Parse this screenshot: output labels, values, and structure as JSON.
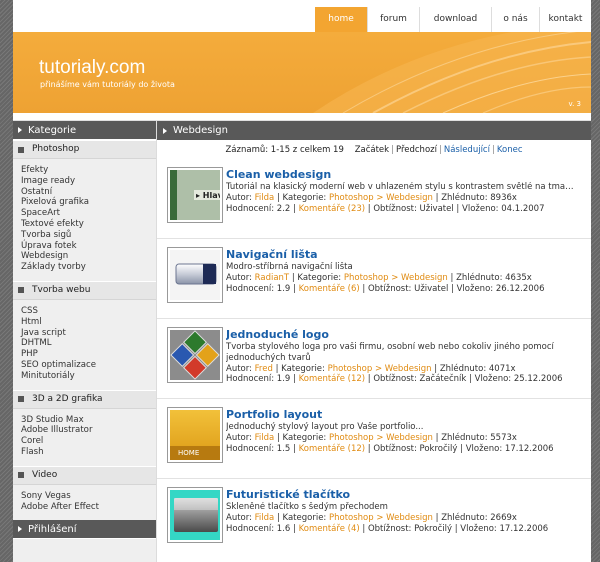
{
  "nav": {
    "items": [
      {
        "label": "home",
        "active": true
      },
      {
        "label": "forum"
      },
      {
        "label": "download"
      },
      {
        "label": "o nás"
      },
      {
        "label": "kontakt"
      }
    ]
  },
  "banner": {
    "title": "tutorialy.com",
    "slogan": "přinášíme vám tutoriály do života",
    "version": "v. 3"
  },
  "sidebar": {
    "heading": "Kategorie",
    "categories": [
      {
        "name": "Photoshop",
        "items": [
          "Efekty",
          "Image ready",
          "Ostatní",
          "Pixelová grafika",
          "SpaceArt",
          "Textové efekty",
          "Tvorba sigů",
          "Úprava fotek",
          "Webdesign",
          "Základy tvorby"
        ]
      },
      {
        "name": "Tvorba webu",
        "items": [
          "CSS",
          "Html",
          "Java script",
          "DHTML",
          "PHP",
          "SEO optimalizace",
          "Minitutoriály"
        ]
      },
      {
        "name": "3D a 2D grafika",
        "items": [
          "3D Studio Max",
          "Adobe Illustrator",
          "Corel",
          "Flash"
        ]
      },
      {
        "name": "Video",
        "items": [
          "Sony Vegas",
          "Adobe After Effect"
        ]
      }
    ],
    "login_heading": "Přihlášení"
  },
  "main": {
    "heading": "Webdesign",
    "pager": {
      "summary": "Záznamů: 1-15 z celkem 19",
      "start": "Začátek",
      "prev": "Předchozí",
      "next": "Následující",
      "end": "Konec"
    },
    "articles": [
      {
        "title": "Clean webdesign",
        "desc": "Tutoriál na klasický moderní web v uhlazeném stylu s kontrastem světlé na tmavém...",
        "author_label": "Autor:",
        "author": "Filda",
        "category_label": "Kategorie:",
        "category": "Photoshop > Webdesign",
        "views": "Zhlédnuto: 8936x",
        "rating": "Hodnocení: 2.2",
        "comments": "Komentáře (23)",
        "difficulty": "Obtížnost: Uživatel",
        "date": "Vloženo: 04.1.2007",
        "thumb": "clean"
      },
      {
        "title": "Navigační lišta",
        "desc": "Modro-stříbrná navigační lišta",
        "author_label": "Autor:",
        "author": "RadianT",
        "category_label": "Kategorie:",
        "category": "Photoshop > Webdesign",
        "views": "Zhlédnuto: 4635x",
        "rating": "Hodnocení: 1.9",
        "comments": "Komentáře (6)",
        "difficulty": "Obtížnost: Uživatel",
        "date": "Vloženo: 26.12.2006",
        "thumb": "nav"
      },
      {
        "title": "Jednoduché logo",
        "desc": "Tvorba stylového loga pro vaši firmu, osobní web nebo cokoliv jiného pomocí jednoduchých tvarů",
        "author_label": "Autor:",
        "author": "Fred",
        "category_label": "Kategorie:",
        "category": "Photoshop > Webdesign",
        "views": "Zhlédnuto: 4071x",
        "rating": "Hodnocení: 1.9",
        "comments": "Komentáře (12)",
        "difficulty": "Obtížnost: Začátečník",
        "date": "Vloženo: 25.12.2006",
        "thumb": "logo"
      },
      {
        "title": "Portfolio layout",
        "desc": "Jednoduchý stylový layout pro Vaše portfolio...",
        "author_label": "Autor:",
        "author": "Filda",
        "category_label": "Kategorie:",
        "category": "Photoshop > Webdesign",
        "views": "Zhlédnuto: 5573x",
        "rating": "Hodnocení: 1.5",
        "comments": "Komentáře (12)",
        "difficulty": "Obtížnost: Pokročilý",
        "date": "Vloženo: 17.12.2006",
        "thumb": "portfolio",
        "thumb_text": "HOME"
      },
      {
        "title": "Futuristické tlačítko",
        "desc": "Skleněné tlačítko s šedým přechodem",
        "author_label": "Autor:",
        "author": "Filda",
        "category_label": "Kategorie:",
        "category": "Photoshop > Webdesign",
        "views": "Zhlédnuto: 2669x",
        "rating": "Hodnocení: 1.6",
        "comments": "Komentáře (4)",
        "difficulty": "Obtížnost: Pokročilý",
        "date": "Vloženo: 17.12.2006",
        "thumb": "button"
      }
    ]
  },
  "colors": {
    "accent": "#f3a531",
    "link": "#1a5fa8",
    "highlight": "#e08b12",
    "dark_bar": "#595959"
  }
}
